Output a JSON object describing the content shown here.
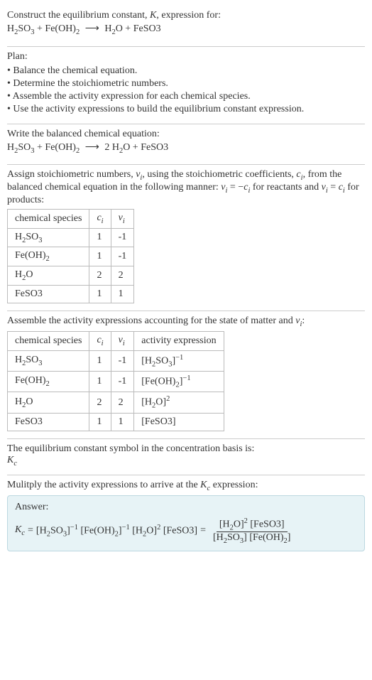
{
  "intro": {
    "lead": "Construct the equilibrium constant, ",
    "K": "K",
    "lead2": ", expression for:",
    "eq_unbalanced": "H₂SO₃ + Fe(OH)₂  ⟶  H₂O + FeSO3"
  },
  "plan": {
    "title": "Plan:",
    "items": [
      "Balance the chemical equation.",
      "Determine the stoichiometric numbers.",
      "Assemble the activity expression for each chemical species.",
      "Use the activity expressions to build the equilibrium constant expression."
    ]
  },
  "balanced": {
    "title": "Write the balanced chemical equation:",
    "eq": "H₂SO₃ + Fe(OH)₂  ⟶  2 H₂O + FeSO3"
  },
  "assign": {
    "para": "Assign stoichiometric numbers, νᵢ, using the stoichiometric coefficients, cᵢ, from the balanced chemical equation in the following manner: νᵢ = −cᵢ for reactants and νᵢ = cᵢ for products:",
    "headers": [
      "chemical species",
      "cᵢ",
      "νᵢ"
    ],
    "rows": [
      {
        "sp": "H₂SO₃",
        "c": "1",
        "v": "-1"
      },
      {
        "sp": "Fe(OH)₂",
        "c": "1",
        "v": "-1"
      },
      {
        "sp": "H₂O",
        "c": "2",
        "v": "2"
      },
      {
        "sp": "FeSO3",
        "c": "1",
        "v": "1"
      }
    ]
  },
  "activity": {
    "title": "Assemble the activity expressions accounting for the state of matter and νᵢ:",
    "headers": [
      "chemical species",
      "cᵢ",
      "νᵢ",
      "activity expression"
    ],
    "rows": [
      {
        "sp": "H₂SO₃",
        "c": "1",
        "v": "-1",
        "a": "[H₂SO₃]⁻¹"
      },
      {
        "sp": "Fe(OH)₂",
        "c": "1",
        "v": "-1",
        "a": "[Fe(OH)₂]⁻¹"
      },
      {
        "sp": "H₂O",
        "c": "2",
        "v": "2",
        "a": "[H₂O]²"
      },
      {
        "sp": "FeSO3",
        "c": "1",
        "v": "1",
        "a": "[FeSO3]"
      }
    ]
  },
  "symbol": {
    "line1": "The equilibrium constant symbol in the concentration basis is:",
    "kc": "K_c"
  },
  "multiply": {
    "title": "Mulitply the activity expressions to arrive at the K_c expression:"
  },
  "answer": {
    "label": "Answer:",
    "kc": "K_c",
    "flat": "[H₂SO₃]⁻¹ [Fe(OH)₂]⁻¹ [H₂O]² [FeSO3]",
    "num": "[H₂O]² [FeSO3]",
    "den": "[H₂SO₃] [Fe(OH)₂]"
  }
}
